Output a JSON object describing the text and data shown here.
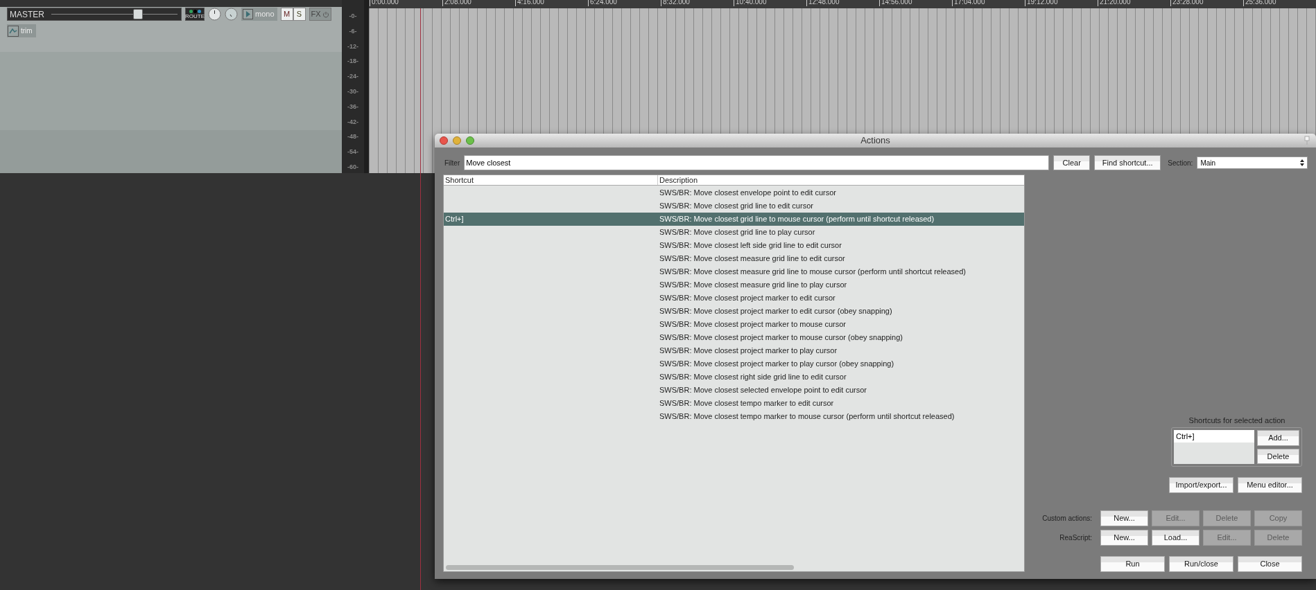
{
  "master_track": {
    "name": "MASTER",
    "volume": {
      "level": 0.7
    },
    "route_label": "ROUTE",
    "mono_label": "mono",
    "mute_label": "M",
    "solo_label": "S",
    "fx_label": "FX",
    "trim_label": "trim"
  },
  "meter_scale": [
    "-0-",
    "-6-",
    "-12-",
    "-18-",
    "-24-",
    "-30-",
    "-36-",
    "-42-",
    "-48-",
    "-54-",
    "-60-"
  ],
  "ruler": [
    "0:00.000",
    "2:08.000",
    "4:16.000",
    "6:24.000",
    "8:32.000",
    "10:40.000",
    "12:48.000",
    "14:56.000",
    "17:04.000",
    "19:12.000",
    "21:20.000",
    "23:28.000",
    "25:36.000"
  ],
  "dialog": {
    "title": "Actions",
    "filter_label": "Filter",
    "filter_value": "Move closest",
    "clear_button": "Clear",
    "find_button": "Find shortcut...",
    "section_label": "Section:",
    "section_value": "Main",
    "columns": [
      "Shortcut",
      "Description"
    ],
    "rows": [
      {
        "description": "SWS/BR: Move closest envelope point to edit cursor",
        "selected": false
      },
      {
        "description": "SWS/BR: Move closest grid line to edit cursor",
        "selected": false
      },
      {
        "shortcut": "Ctrl+]",
        "description": "SWS/BR: Move closest grid line to mouse cursor (perform until shortcut released)",
        "selected": true
      },
      {
        "description": "SWS/BR: Move closest grid line to play cursor",
        "selected": false
      },
      {
        "description": "SWS/BR: Move closest left side grid line to edit cursor",
        "selected": false
      },
      {
        "description": "SWS/BR: Move closest measure grid line to edit cursor",
        "selected": false
      },
      {
        "description": "SWS/BR: Move closest measure grid line to mouse cursor (perform until shortcut released)",
        "selected": false
      },
      {
        "description": "SWS/BR: Move closest measure grid line to play cursor",
        "selected": false
      },
      {
        "description": "SWS/BR: Move closest project marker to edit cursor",
        "selected": false
      },
      {
        "description": "SWS/BR: Move closest project marker to edit cursor (obey snapping)",
        "selected": false
      },
      {
        "description": "SWS/BR: Move closest project marker to mouse cursor",
        "selected": false
      },
      {
        "description": "SWS/BR: Move closest project marker to mouse cursor (obey snapping)",
        "selected": false
      },
      {
        "description": "SWS/BR: Move closest project marker to play cursor",
        "selected": false
      },
      {
        "description": "SWS/BR: Move closest project marker to play cursor (obey snapping)",
        "selected": false
      },
      {
        "description": "SWS/BR: Move closest right side grid line to edit cursor",
        "selected": false
      },
      {
        "description": "SWS/BR: Move closest selected envelope point to edit cursor",
        "selected": false
      },
      {
        "description": "SWS/BR: Move closest tempo marker to edit cursor",
        "selected": false
      },
      {
        "description": "SWS/BR: Move closest tempo marker to mouse cursor (perform until shortcut released)",
        "selected": false
      }
    ],
    "shortcuts_label": "Shortcuts for selected action",
    "shortcuts": [
      "Ctrl+]"
    ],
    "shortcut_buttons": [
      {
        "label": "Add...",
        "disabled": false
      },
      {
        "label": "Delete",
        "disabled": false
      }
    ],
    "tool_buttons": [
      {
        "label": "Import/export...",
        "disabled": false
      },
      {
        "label": "Menu editor...",
        "disabled": false
      }
    ],
    "custom_actions": {
      "label": "Custom actions:",
      "buttons": [
        {
          "label": "New...",
          "disabled": false
        },
        {
          "label": "Edit...",
          "disabled": true
        },
        {
          "label": "Delete",
          "disabled": true
        },
        {
          "label": "Copy",
          "disabled": true
        }
      ]
    },
    "reascript": {
      "label": "ReaScript:",
      "buttons": [
        {
          "label": "New...",
          "disabled": false
        },
        {
          "label": "Load...",
          "disabled": false
        },
        {
          "label": "Edit...",
          "disabled": true
        },
        {
          "label": "Delete",
          "disabled": true
        }
      ]
    },
    "footer_buttons": [
      {
        "label": "Run",
        "disabled": false
      },
      {
        "label": "Run/close",
        "disabled": false
      },
      {
        "label": "Close",
        "disabled": false
      }
    ]
  }
}
